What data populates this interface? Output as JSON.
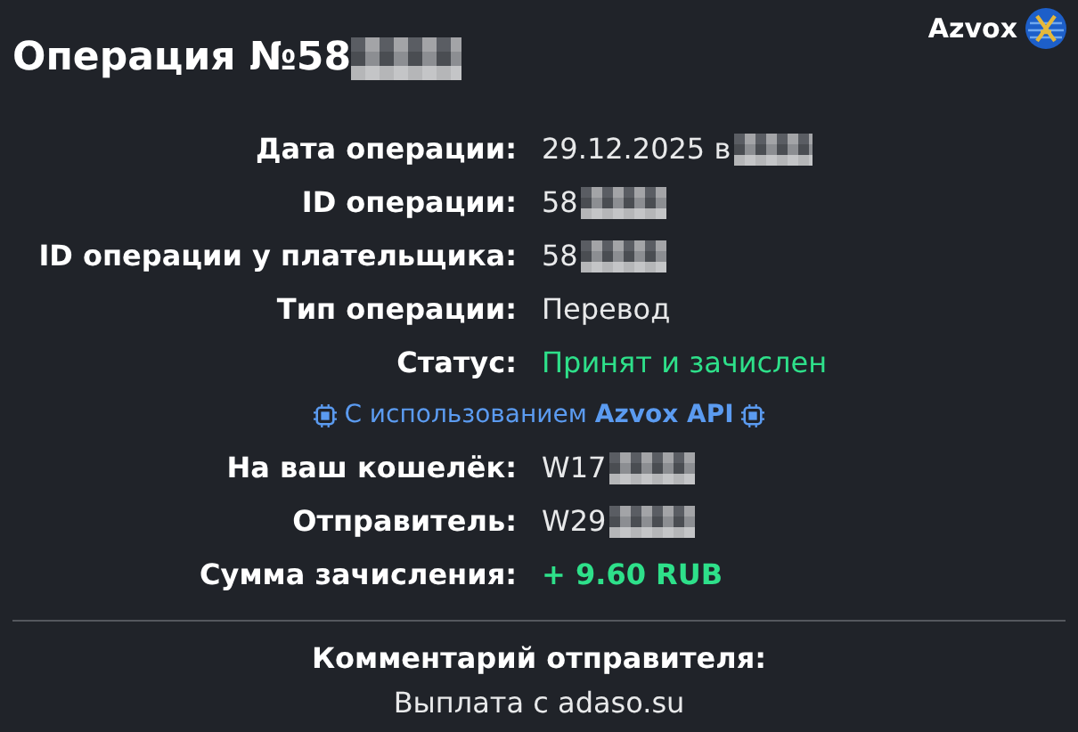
{
  "brand": {
    "name": "Azvox"
  },
  "title": {
    "text": "Операция №58",
    "redacted": true
  },
  "fields": [
    {
      "label": "Дата операции:",
      "value": "29.12.2025 в",
      "kind": "plain",
      "redacted": true
    },
    {
      "label": "ID операции:",
      "value": "58",
      "kind": "plain",
      "redacted": true
    },
    {
      "label": "ID операции у плательщика:",
      "value": "58",
      "kind": "plain",
      "redacted": true
    },
    {
      "label": "Тип операции:",
      "value": "Перевод",
      "kind": "plain",
      "redacted": false
    },
    {
      "label": "Статус:",
      "value": "Принят и зачислен",
      "kind": "status",
      "redacted": false
    },
    {
      "kind": "note",
      "text": "С использованием **Azvox API**"
    },
    {
      "label": "На ваш кошелёк:",
      "value": "W17",
      "kind": "plain",
      "redacted": true
    },
    {
      "label": "Отправитель:",
      "value": "W29",
      "kind": "plain",
      "redacted": true
    },
    {
      "label": "Сумма зачисления:",
      "value": "+ 9.60 RUB",
      "kind": "amount",
      "redacted": false
    }
  ],
  "comment": {
    "label": "Комментарий отправителя:",
    "text": "Выплата с adaso.su"
  }
}
